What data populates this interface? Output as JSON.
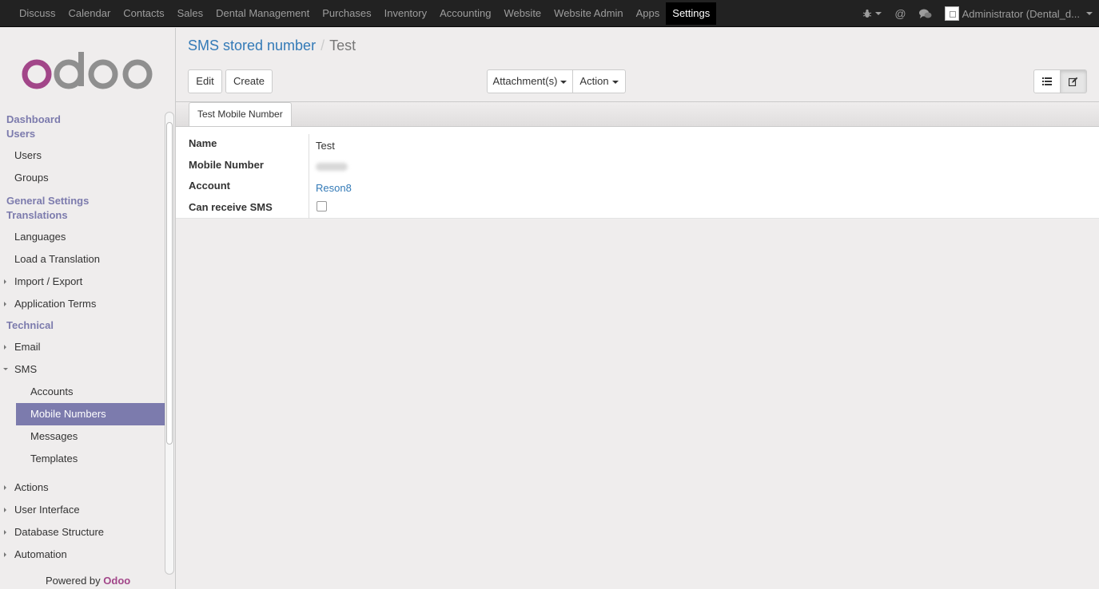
{
  "top_menu": [
    "Discuss",
    "Calendar",
    "Contacts",
    "Sales",
    "Dental Management",
    "Purchases",
    "Inventory",
    "Accounting",
    "Website",
    "Website Admin",
    "Apps",
    "Settings"
  ],
  "top_menu_active": "Settings",
  "user_menu": {
    "label": "Administrator (Dental_d..."
  },
  "brand": {
    "logo_text": "odoo",
    "logo_color_o": "#a24689",
    "logo_color_rest": "#8f8f8f",
    "accent": "#7c7bad"
  },
  "sidebar": {
    "dashboard": "Dashboard",
    "users_head": "Users",
    "users": "Users",
    "groups": "Groups",
    "general_settings": "General Settings",
    "translations_head": "Translations",
    "languages": "Languages",
    "load_translation": "Load a Translation",
    "import_export": "Import / Export",
    "application_terms": "Application Terms",
    "technical_head": "Technical",
    "email": "Email",
    "sms": "SMS",
    "accounts": "Accounts",
    "mobile_numbers": "Mobile Numbers",
    "messages": "Messages",
    "templates": "Templates",
    "actions": "Actions",
    "user_interface": "User Interface",
    "database_structure": "Database Structure",
    "automation": "Automation"
  },
  "powered_by": {
    "prefix": "Powered by",
    "brand": "Odoo"
  },
  "breadcrumb": {
    "parent": "SMS stored number",
    "separator": "/",
    "current": "Test"
  },
  "buttons": {
    "edit": "Edit",
    "create": "Create",
    "attachments": "Attachment(s)",
    "action": "Action"
  },
  "tab": {
    "label": "Test Mobile Number"
  },
  "form": {
    "name_label": "Name",
    "name_value": "Test",
    "mobile_label": "Mobile Number",
    "account_label": "Account",
    "account_value": "Reson8",
    "receive_label": "Can receive SMS",
    "receive_checked": false
  }
}
